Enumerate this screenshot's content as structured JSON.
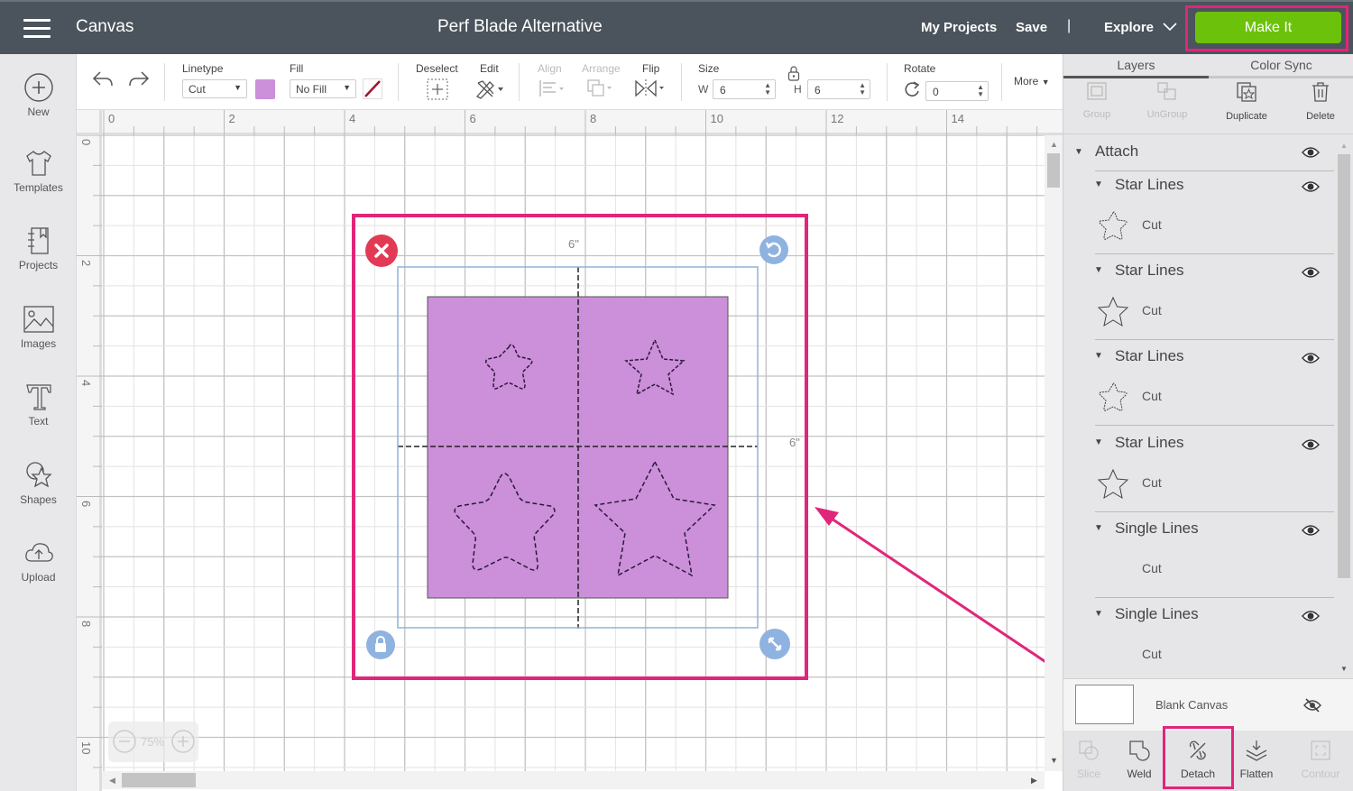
{
  "topbar": {
    "app_name": "Canvas",
    "project_title": "Perf Blade Alternative",
    "my_projects": "My Projects",
    "save": "Save",
    "separator": "|",
    "explore": "Explore",
    "make_it": "Make It"
  },
  "sidebar": {
    "items": [
      {
        "label": "New",
        "icon": "plus-circle-icon"
      },
      {
        "label": "Templates",
        "icon": "tshirt-icon"
      },
      {
        "label": "Projects",
        "icon": "notebook-icon"
      },
      {
        "label": "Images",
        "icon": "image-icon"
      },
      {
        "label": "Text",
        "icon": "text-icon"
      },
      {
        "label": "Shapes",
        "icon": "shapes-icon"
      },
      {
        "label": "Upload",
        "icon": "cloud-upload-icon"
      }
    ]
  },
  "toolbar": {
    "linetype_label": "Linetype",
    "linetype_value": "Cut",
    "linetype_color": "#cc8fd9",
    "fill_label": "Fill",
    "fill_value": "No Fill",
    "deselect_label": "Deselect",
    "edit_label": "Edit",
    "align_label": "Align",
    "arrange_label": "Arrange",
    "flip_label": "Flip",
    "size_label": "Size",
    "w_label": "W",
    "w_value": "6",
    "h_label": "H",
    "h_value": "6",
    "rotate_label": "Rotate",
    "rotate_value": "0",
    "more_label": "More"
  },
  "rulers": {
    "top": [
      "0",
      "2",
      "4",
      "6",
      "8",
      "10",
      "12",
      "14"
    ],
    "left": [
      "0",
      "2",
      "4",
      "6",
      "8",
      "10"
    ]
  },
  "canvas": {
    "width_label": "6\"",
    "height_label": "6\"",
    "zoom": "75%",
    "design_fill": "#cc8fd9",
    "highlight_color": "#e0267a",
    "selection_color": "#8fb3d9"
  },
  "panel": {
    "tabs": [
      "Layers",
      "Color Sync"
    ],
    "actions": [
      {
        "label": "Group",
        "enabled": false
      },
      {
        "label": "UnGroup",
        "enabled": false
      },
      {
        "label": "Duplicate",
        "enabled": true
      },
      {
        "label": "Delete",
        "enabled": true
      }
    ],
    "layers": {
      "group_name": "Attach",
      "children": [
        {
          "name": "Star Lines",
          "type": "Cut"
        },
        {
          "name": "Star Lines",
          "type": "Cut"
        },
        {
          "name": "Star Lines",
          "type": "Cut"
        },
        {
          "name": "Star Lines",
          "type": "Cut"
        },
        {
          "name": "Single Lines",
          "type": "Cut"
        },
        {
          "name": "Single Lines",
          "type": "Cut"
        }
      ]
    },
    "blank_canvas": "Blank Canvas",
    "bottom_tools": [
      {
        "label": "Slice",
        "enabled": false
      },
      {
        "label": "Weld",
        "enabled": true
      },
      {
        "label": "Detach",
        "enabled": true
      },
      {
        "label": "Flatten",
        "enabled": true
      },
      {
        "label": "Contour",
        "enabled": false
      }
    ]
  }
}
